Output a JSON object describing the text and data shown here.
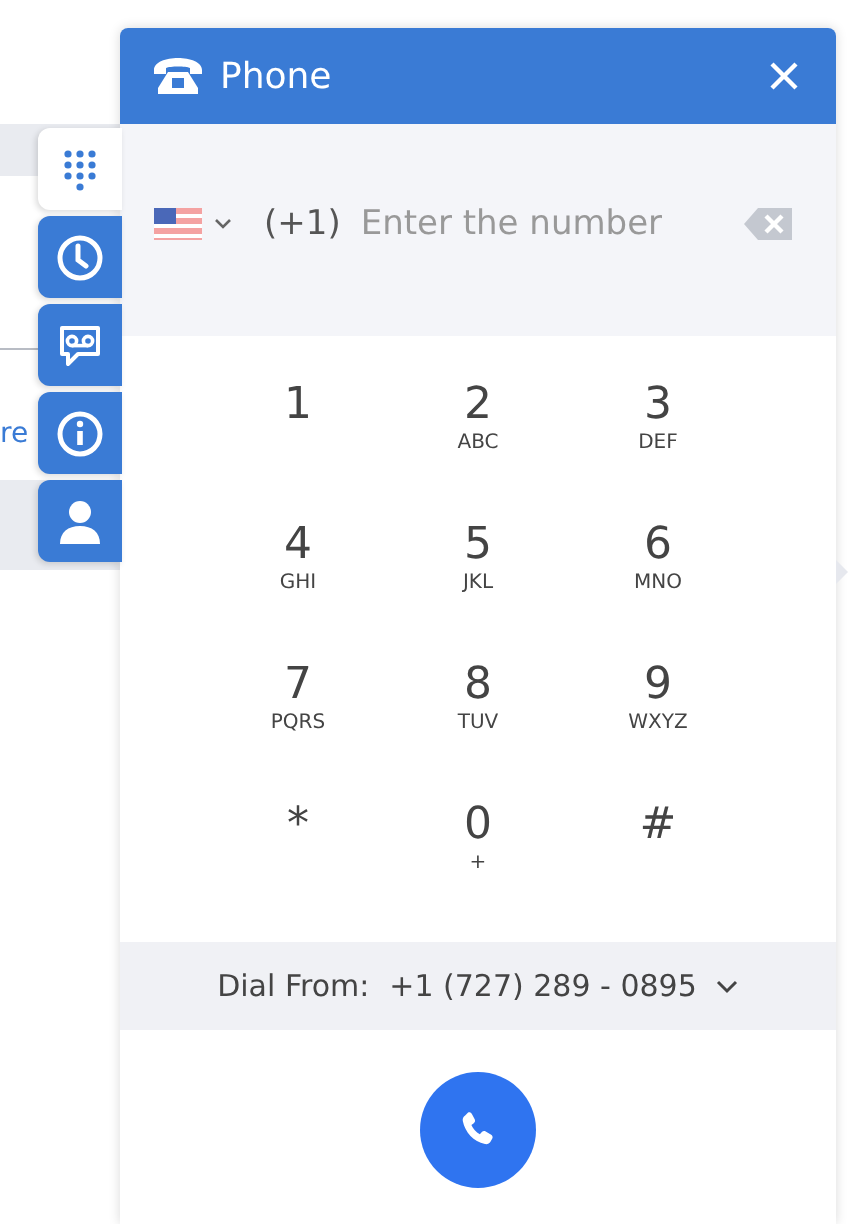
{
  "background": {
    "link_text": "re"
  },
  "side_tabs": [
    {
      "kind": "dialpad",
      "selected": true
    },
    {
      "kind": "history",
      "selected": false
    },
    {
      "kind": "voicemail",
      "selected": false
    },
    {
      "kind": "info",
      "selected": false
    },
    {
      "kind": "contact",
      "selected": false
    }
  ],
  "window": {
    "title": "Phone"
  },
  "number_field": {
    "country_code": "(+1)",
    "placeholder": "Enter the number"
  },
  "keys": [
    {
      "digit": "1"
    },
    {
      "digit": "2",
      "letters": "ABC"
    },
    {
      "digit": "3",
      "letters": "DEF"
    },
    {
      "digit": "4",
      "letters": "GHI"
    },
    {
      "digit": "5",
      "letters": "JKL"
    },
    {
      "digit": "6",
      "letters": "MNO"
    },
    {
      "digit": "7",
      "letters": "PQRS"
    },
    {
      "digit": "8",
      "letters": "TUV"
    },
    {
      "digit": "9",
      "letters": "WXYZ"
    },
    {
      "digit": "*"
    },
    {
      "digit": "0",
      "letters": "+"
    },
    {
      "digit": "#"
    }
  ],
  "dial_from": {
    "label": "Dial From:",
    "number": "+1 (727) 289 - 0895"
  }
}
